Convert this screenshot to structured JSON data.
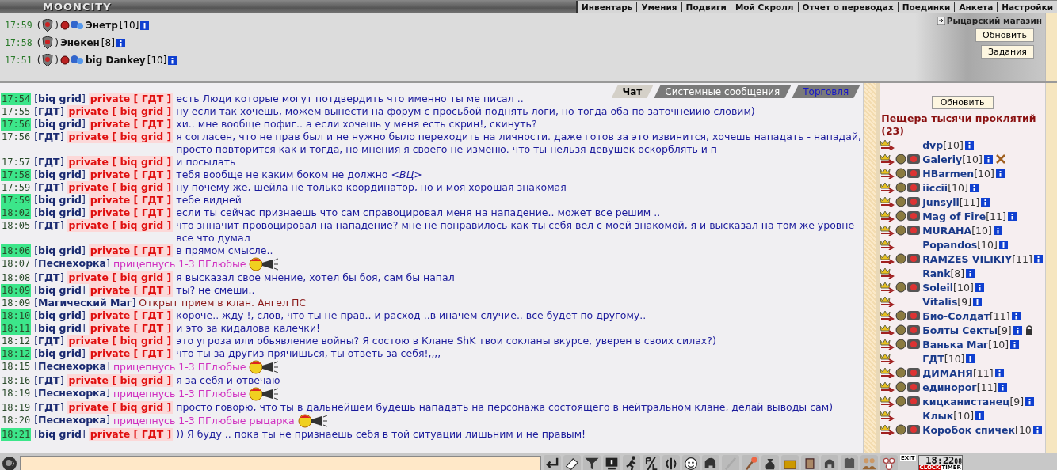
{
  "header": {
    "logo": "MOONCITY",
    "menu": [
      "Инвентарь",
      "Умения",
      "Подвиги",
      "Мой Скролл",
      "Отчет о переводах",
      "Поединки",
      "Анкета",
      "Настройки"
    ]
  },
  "visitors": [
    {
      "time": "17:59",
      "open": "(",
      "close": ")",
      "name": "Энетр",
      "level": "[10]",
      "emblem": true
    },
    {
      "time": "17:58",
      "open": "(",
      "close": ")",
      "name": "Энекен",
      "level": "[8]",
      "emblem": false
    },
    {
      "time": "17:51",
      "open": "(",
      "close": ")",
      "name": "big Dankey",
      "level": "[10]",
      "emblem": true
    }
  ],
  "shop_link": "Рыцарский магазин",
  "top_buttons": [
    "Обновить",
    "Задания"
  ],
  "tabs": [
    {
      "label": "Чат",
      "selected": true,
      "unread": false
    },
    {
      "label": "Системные сообщения",
      "selected": false,
      "unread": false
    },
    {
      "label": "Торговля",
      "selected": false,
      "unread": true
    }
  ],
  "messages": [
    {
      "time": "17:54",
      "highlighted": true,
      "sender": "[**biq grid**]",
      "kind": "private",
      "recipient": "private [ ГДТ ]",
      "text": "есть Люди которые могут потдвердить что именно ты ме писал .."
    },
    {
      "time": "17:55",
      "highlighted": false,
      "sender": "[**ГДТ**]",
      "kind": "private",
      "recipient": "private [ biq grid ]",
      "text": "ну если так хочешь, можем вынести на форум с просьбой поднять логи, но тогда оба по заточнеиию словим)"
    },
    {
      "time": "17:56",
      "highlighted": true,
      "sender": "[**biq grid**]",
      "kind": "private",
      "recipient": "private [ ГДТ ]",
      "text": "хи.. мне вообще пофиг.. а если хочешь у меня есть скрин!, скинуть?"
    },
    {
      "time": "17:56",
      "highlighted": false,
      "sender": "[**ГДТ**]",
      "kind": "private",
      "recipient": "private [ biq grid ]",
      "text": "я согласен, что не прав был и не нужно было переходить на личности. даже готов за это извинится, хочешь нападать - нападай, просто повторится как и тогда, но мнения я своего не изменю. что ты нельзя девушек оскорблять и п"
    },
    {
      "time": "17:57",
      "highlighted": false,
      "sender": "[**ГДТ**]",
      "kind": "private",
      "recipient": "private [ biq grid ]",
      "text": "и посылать"
    },
    {
      "time": "17:58",
      "highlighted": true,
      "sender": "[**biq grid**]",
      "kind": "private",
      "recipient": "private [ ГДТ ]",
      "text": "тебя вообще не каким боком не должно *<ВЦ>*"
    },
    {
      "time": "17:59",
      "highlighted": false,
      "sender": "[**ГДТ**]",
      "kind": "private",
      "recipient": "private [ biq grid ]",
      "text": "ну почему же, шейла не только координатор, но и моя хорошая знакомая"
    },
    {
      "time": "17:59",
      "highlighted": true,
      "sender": "[**biq grid**]",
      "kind": "private",
      "recipient": "private [ ГДТ ]",
      "text": "тебе видней"
    },
    {
      "time": "18:02",
      "highlighted": true,
      "sender": "[**biq grid**]",
      "kind": "private",
      "recipient": "private [ ГДТ ]",
      "text": "если ты сейчас признаешь что сам справоцировал меня на нападение.. может все решим .."
    },
    {
      "time": "18:05",
      "highlighted": false,
      "sender": "[**ГДТ**]",
      "kind": "private",
      "recipient": "private [ biq grid ]",
      "text": "что знначит провоцировал на нападение? мне не понравилось как ты себя вел с моей знакомой, я и высказал на том же уровне все что думал"
    },
    {
      "time": "18:06",
      "highlighted": true,
      "sender": "[**biq grid**]",
      "kind": "private",
      "recipient": "private [ ГДТ ]",
      "text": "в прямом смысле.."
    },
    {
      "time": "18:07",
      "highlighted": false,
      "sender": "[**Песнехорка**]",
      "kind": "public",
      "text": "прицепнусь 1-3 ПГлюбые"
    },
    {
      "time": "18:08",
      "highlighted": false,
      "sender": "[**ГДТ**]",
      "kind": "private",
      "recipient": "private [ biq grid ]",
      "text": "я высказал свое мнение, хотел бы боя, сам бы напал"
    },
    {
      "time": "18:09",
      "highlighted": true,
      "sender": "[**biq grid**]",
      "kind": "private",
      "recipient": "private [ ГДТ ]",
      "text": "ты? не смеши.."
    },
    {
      "time": "18:09",
      "highlighted": false,
      "sender": "[**Магический Маг**]",
      "kind": "system",
      "text": "Открыт прием в клан. Ангел ПС"
    },
    {
      "time": "18:10",
      "highlighted": true,
      "sender": "[**biq grid**]",
      "kind": "private",
      "recipient": "private [ ГДТ ]",
      "text": "короче.. жду !, слов, что ты не прав.. и расход ..в иначем случие.. все будет по другому.."
    },
    {
      "time": "18:11",
      "highlighted": true,
      "sender": "[**biq grid**]",
      "kind": "private",
      "recipient": "private [ ГДТ ]",
      "text": "и это за кидалова калечки!"
    },
    {
      "time": "18:12",
      "highlighted": false,
      "sender": "[**ГДТ**]",
      "kind": "private",
      "recipient": "private [ biq grid ]",
      "text": "это угроза или обьявление войны? Я состою в Клане ShK твои сокланы вкурсе, уверен в своих силах?)"
    },
    {
      "time": "18:12",
      "highlighted": true,
      "sender": "[**biq grid**]",
      "kind": "private",
      "recipient": "private [ ГДТ ]",
      "text": "что ты за другиз прячишься, ты ответь за себя!,,,,"
    },
    {
      "time": "18:15",
      "highlighted": false,
      "sender": "[**Песнехорка**]",
      "kind": "public",
      "text": "прицепнусь 1-3 ПГлюбые"
    },
    {
      "time": "18:16",
      "highlighted": false,
      "sender": "[**ГДТ**]",
      "kind": "private",
      "recipient": "private [ biq grid ]",
      "text": "я за себя и отвечаю"
    },
    {
      "time": "18:19",
      "highlighted": false,
      "sender": "[**Песнехорка**]",
      "kind": "public",
      "text": "прицепнусь 1-3 ПГлюбые"
    },
    {
      "time": "18:19",
      "highlighted": false,
      "sender": "[**ГДТ**]",
      "kind": "private",
      "recipient": "private [ biq grid ]",
      "text": "просто говорю, что ты в дальнейшем будешь нападать на персонажа состоящего в нейтральном клане, делай выводы сам)"
    },
    {
      "time": "18:20",
      "highlighted": false,
      "sender": "[**Песнехорка**]",
      "kind": "public",
      "text": "прицепнусь 1-3 ПГлюбые рыцарка"
    },
    {
      "time": "18:21",
      "highlighted": true,
      "sender": "[**biq grid**]",
      "kind": "private",
      "recipient": "private [ ГДТ ]",
      "text": ")) Я буду .. пока ты не признаешь себя в той ситуации лишьним и не правым!"
    }
  ],
  "room": {
    "refresh": "Обновить",
    "title": "Пещера тысячи проклятий (23)",
    "users": [
      {
        "name": "dvp",
        "level": "[10]",
        "clan": false,
        "ignored": false,
        "locked": false
      },
      {
        "name": "Galeriy",
        "level": "[10]",
        "clan": true,
        "ignored": true,
        "locked": false
      },
      {
        "name": "HBarmen",
        "level": "[10]",
        "clan": true,
        "ignored": false,
        "locked": false
      },
      {
        "name": "iiccii",
        "level": "[10]",
        "clan": true,
        "ignored": false,
        "locked": false
      },
      {
        "name": "Junsyll",
        "level": "[11]",
        "clan": true,
        "ignored": false,
        "locked": false
      },
      {
        "name": "Mag of Fire",
        "level": "[11]",
        "clan": true,
        "ignored": false,
        "locked": false
      },
      {
        "name": "MURAHA",
        "level": "[10]",
        "clan": true,
        "ignored": false,
        "locked": false
      },
      {
        "name": "Popandos",
        "level": "[10]",
        "clan": false,
        "ignored": false,
        "locked": false
      },
      {
        "name": "RAMZES VILIKIY",
        "level": "[11]",
        "clan": true,
        "ignored": false,
        "locked": false
      },
      {
        "name": "Rank",
        "level": "[8]",
        "clan": false,
        "ignored": false,
        "locked": false
      },
      {
        "name": "Soleil",
        "level": "[10]",
        "clan": true,
        "ignored": false,
        "locked": false
      },
      {
        "name": "Vitalis",
        "level": "[9]",
        "clan": false,
        "ignored": false,
        "locked": false
      },
      {
        "name": "Био-Солдат",
        "level": "[11]",
        "clan": true,
        "ignored": false,
        "locked": false
      },
      {
        "name": "Болты Секты",
        "level": "[9]",
        "clan": true,
        "ignored": false,
        "locked": true
      },
      {
        "name": "Ванька Маг",
        "level": "[10]",
        "clan": true,
        "ignored": false,
        "locked": false
      },
      {
        "name": "ГДТ",
        "level": "[10]",
        "clan": false,
        "ignored": false,
        "locked": false
      },
      {
        "name": "ДИМАНЯ",
        "level": "[11]",
        "clan": true,
        "ignored": false,
        "locked": false
      },
      {
        "name": "единорог",
        "level": "[11]",
        "clan": true,
        "ignored": false,
        "locked": false
      },
      {
        "name": "кицканистанец",
        "level": "[9]",
        "clan": true,
        "ignored": false,
        "locked": false
      },
      {
        "name": "Клык",
        "level": "[10]",
        "clan": false,
        "ignored": false,
        "locked": false
      },
      {
        "name": "Коробок спичек",
        "level": "[10",
        "clan": true,
        "ignored": false,
        "locked": false
      }
    ]
  },
  "toolbar": {
    "exit": "EXIT",
    "clock": "18:22",
    "seconds": "08",
    "clock_label": "CLOCK",
    "timer_label": "TIMER"
  }
}
